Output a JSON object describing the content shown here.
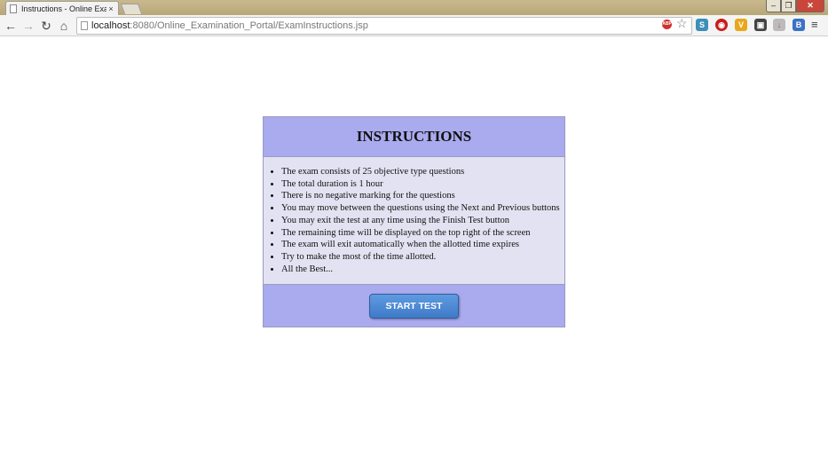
{
  "browser": {
    "tab_title": "Instructions - Online Exam",
    "tab_close": "×",
    "url_host": "localhost",
    "url_rest": ":8080/Online_Examination_Portal/ExamInstructions.jsp",
    "abp_label": "ABP",
    "ext_labels": [
      "S",
      "◉",
      "V",
      "▣",
      "↓",
      "B"
    ]
  },
  "instructions": {
    "title": "INSTRUCTIONS",
    "items": [
      "The exam consists of 25 objective type questions",
      "The total duration is 1 hour",
      "There is no negative marking for the questions",
      "You may move between the questions using the Next and Previous buttons",
      "You may exit the test at any time using the Finish Test button",
      "The remaining time will be displayed on the top right of the screen",
      "The exam will exit automatically when the allotted time expires",
      "Try to make the most of the time allotted.",
      "All the Best..."
    ],
    "start_button": "START TEST"
  },
  "colors": {
    "panel_header_bg": "#aaaaee",
    "panel_body_bg": "#e2e2f2",
    "button_bg": "#4a86d4"
  }
}
